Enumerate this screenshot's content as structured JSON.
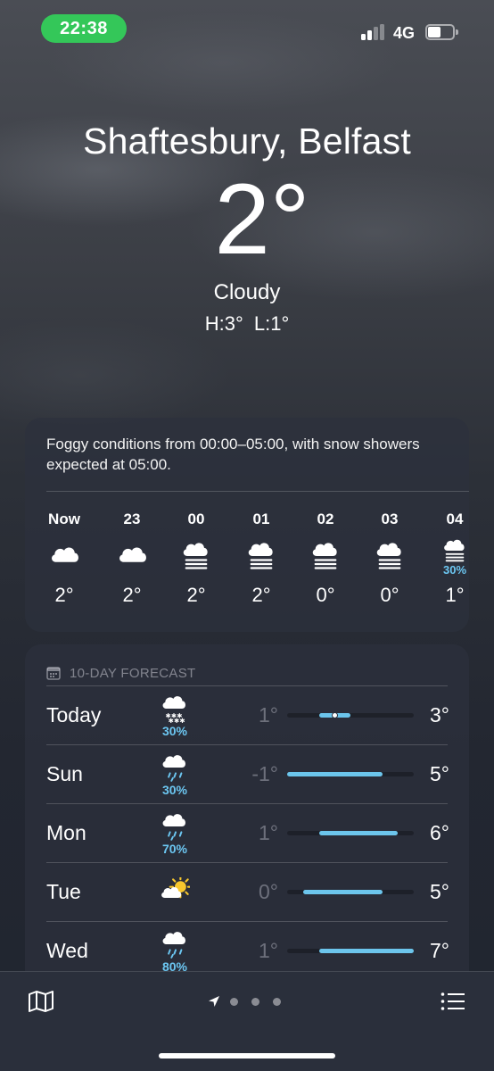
{
  "status_bar": {
    "time": "22:38",
    "network": "4G",
    "signal_bars": 2,
    "battery_level": 0.5
  },
  "header": {
    "location": "Shaftesbury, Belfast",
    "temperature": "2°",
    "condition": "Cloudy",
    "high": "H:3°",
    "low": "L:1°"
  },
  "hourly": {
    "summary": "Foggy conditions from 00:00–05:00, with snow showers expected at 05:00.",
    "hours": [
      {
        "label": "Now",
        "icon": "cloud-icon",
        "temp": "2°",
        "pct": ""
      },
      {
        "label": "23",
        "icon": "cloud-icon",
        "temp": "2°",
        "pct": ""
      },
      {
        "label": "00",
        "icon": "fog-icon",
        "temp": "2°",
        "pct": ""
      },
      {
        "label": "01",
        "icon": "fog-icon",
        "temp": "2°",
        "pct": ""
      },
      {
        "label": "02",
        "icon": "fog-icon",
        "temp": "0°",
        "pct": ""
      },
      {
        "label": "03",
        "icon": "fog-icon",
        "temp": "0°",
        "pct": ""
      },
      {
        "label": "04",
        "icon": "fog-icon",
        "temp": "1°",
        "pct": "30%"
      }
    ]
  },
  "forecast": {
    "title": "10-DAY FORECAST",
    "scale_min": -1,
    "scale_max": 7,
    "days": [
      {
        "day": "Today",
        "icon": "snow-icon",
        "pct": "30%",
        "low": "1°",
        "high": "3°",
        "low_val": 1,
        "high_val": 3,
        "current": 2
      },
      {
        "day": "Sun",
        "icon": "rain-icon",
        "pct": "30%",
        "low": "-1°",
        "high": "5°",
        "low_val": -1,
        "high_val": 5
      },
      {
        "day": "Mon",
        "icon": "rain-icon",
        "pct": "70%",
        "low": "1°",
        "high": "6°",
        "low_val": 1,
        "high_val": 6
      },
      {
        "day": "Tue",
        "icon": "partly-sunny-icon",
        "pct": "",
        "low": "0°",
        "high": "5°",
        "low_val": 0,
        "high_val": 5
      },
      {
        "day": "Wed",
        "icon": "rain-icon",
        "pct": "80%",
        "low": "1°",
        "high": "7°",
        "low_val": 1,
        "high_val": 7
      }
    ]
  },
  "colors": {
    "accent_blue": "#6cc7f2",
    "time_pill": "#34c759"
  }
}
